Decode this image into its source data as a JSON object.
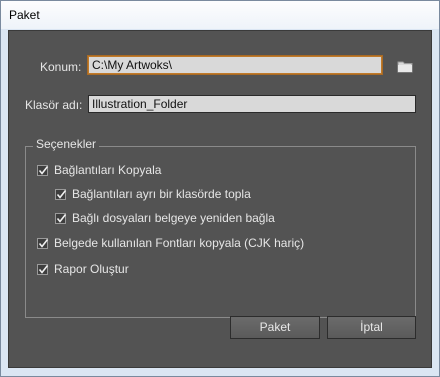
{
  "window": {
    "title": "Paket"
  },
  "form": {
    "location_label": "Konum:",
    "location_value": "C:\\My Artwoks\\",
    "folder_label": "Klasör adı:",
    "folder_value": "Illustration_Folder"
  },
  "options": {
    "title": "Seçenekler",
    "items": [
      {
        "label": "Bağlantıları Kopyala",
        "checked": true
      },
      {
        "label": "Bağlantıları ayrı bir klasörde topla",
        "checked": true
      },
      {
        "label": "Bağlı dosyaları belgeye yeniden bağla",
        "checked": true
      },
      {
        "label": "Belgede kullanılan Fontları kopyala (CJK hariç)",
        "checked": true
      },
      {
        "label": "Rapor Oluştur",
        "checked": true
      }
    ]
  },
  "buttons": {
    "ok_label": "Paket",
    "cancel_label": "İptal"
  },
  "icons": {
    "folder": "folder-icon",
    "checkmark": "checkmark-icon"
  }
}
